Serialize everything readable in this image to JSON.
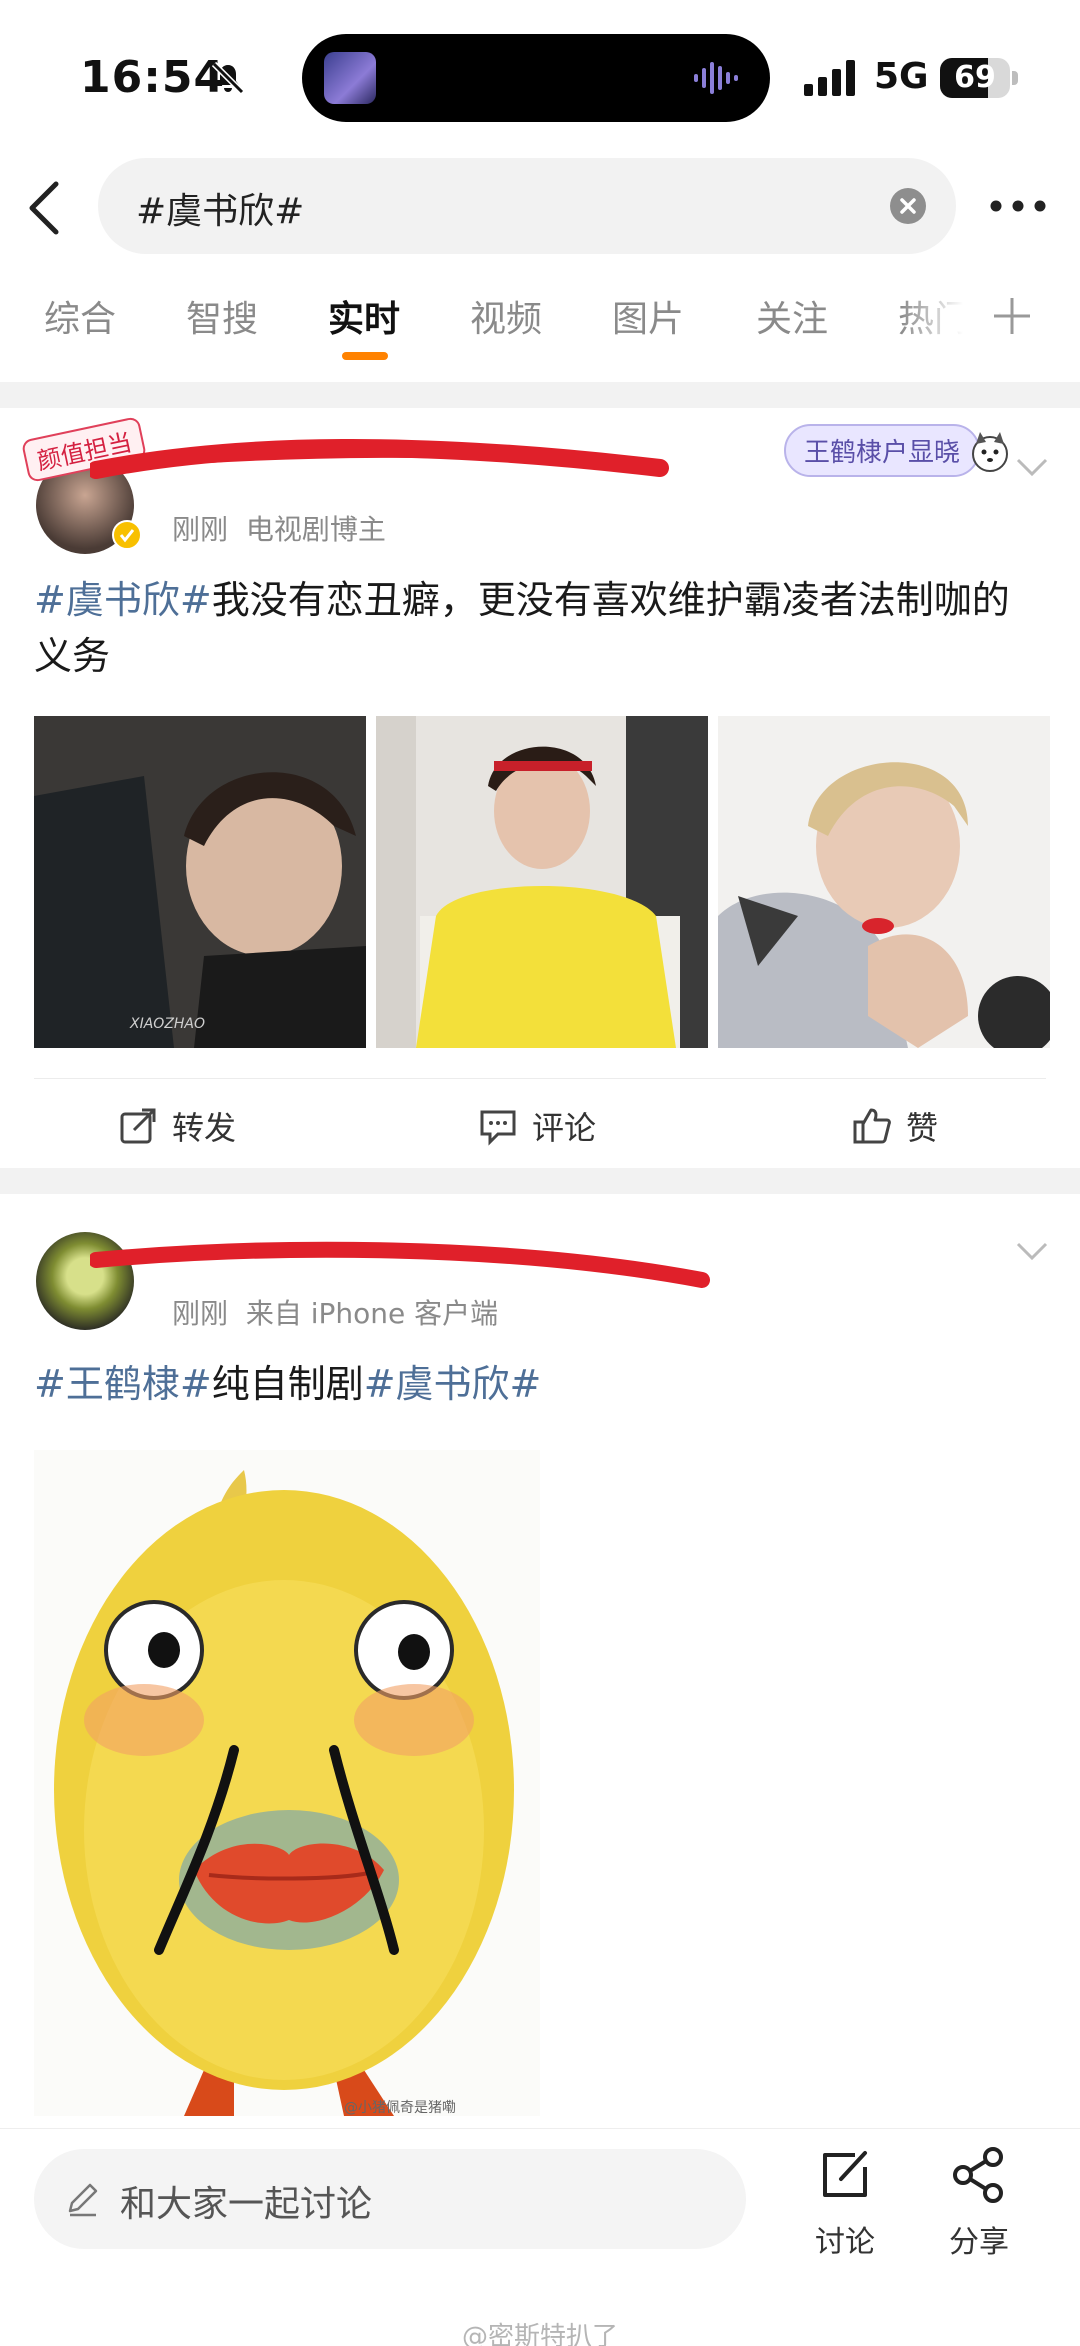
{
  "status_bar": {
    "time": "16:54",
    "network": "5G",
    "battery": "69",
    "battery_level": 0.69
  },
  "search": {
    "query": "#虞书欣#"
  },
  "tabs": [
    {
      "label": "综合"
    },
    {
      "label": "智搜"
    },
    {
      "label": "实时",
      "active": true
    },
    {
      "label": "视频"
    },
    {
      "label": "图片"
    },
    {
      "label": "关注"
    },
    {
      "label": "热门"
    }
  ],
  "post1": {
    "avatar_badge": "颜值担当",
    "time": "刚刚",
    "source": "电视剧博主",
    "sticker": "王鹤棣户显晓",
    "text_tag": "#虞书欣#",
    "text_body": "我没有恋丑癖，更没有喜欢维护霸凌者法制咖的义务",
    "image_watermark": "XIAOZHAO",
    "actions": {
      "repost": "转发",
      "comment": "评论",
      "like": "赞"
    }
  },
  "post2": {
    "time": "刚刚",
    "source": "来自 iPhone 客户端",
    "tag1": "#王鹤棣#",
    "plain": "纯自制剧",
    "tag2": "#虞书欣#",
    "image_caption": "@小猪佩奇是猪嘞"
  },
  "bottom_bar": {
    "input_placeholder": "和大家一起讨论",
    "discuss_label": "讨论",
    "share_label": "分享"
  },
  "watermark": "@密斯特扒了",
  "colors": {
    "accent": "#ff8200",
    "hashtag": "#4e6f97",
    "redaction": "#e0202a"
  }
}
